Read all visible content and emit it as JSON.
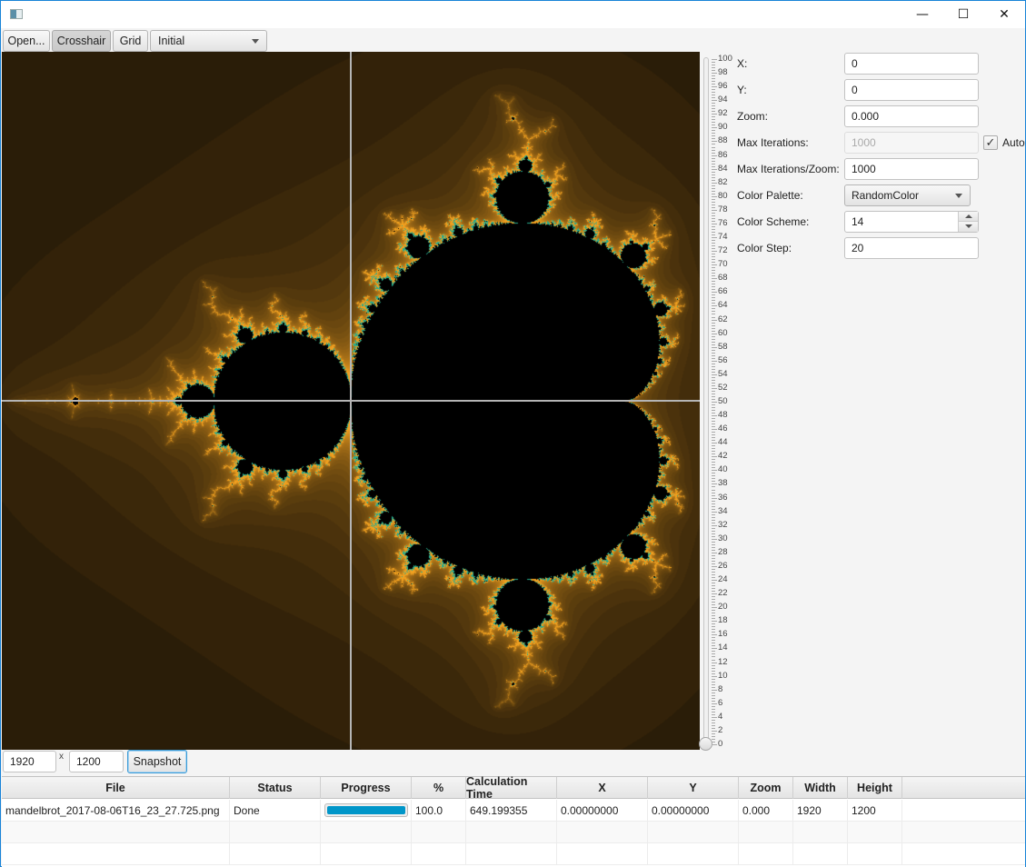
{
  "window": {
    "title": "",
    "controls": {
      "minimize": "—",
      "maximize": "☐",
      "close": "✕"
    }
  },
  "toolbar": {
    "open_label": "Open...",
    "crosshair_label": "Crosshair",
    "crosshair_pressed": true,
    "grid_label": "Grid",
    "preset_selected": "Initial"
  },
  "canvas": {
    "description": "Mandelbrot set render",
    "crosshair_visible": true,
    "colors": {
      "background": "#0c0904",
      "set": "#000000",
      "edge": "#f0a020",
      "crosshair": "#b5b5b5"
    }
  },
  "zoom_slider": {
    "min": 0,
    "max": 100,
    "value": 0,
    "tick_labels": [
      "100",
      "98",
      "96",
      "94",
      "92",
      "90",
      "88",
      "86",
      "84",
      "82",
      "80",
      "78",
      "76",
      "74",
      "72",
      "70",
      "68",
      "66",
      "64",
      "62",
      "60",
      "58",
      "56",
      "54",
      "52",
      "50",
      "48",
      "46",
      "44",
      "42",
      "40",
      "38",
      "36",
      "34",
      "32",
      "30",
      "28",
      "26",
      "24",
      "22",
      "20",
      "18",
      "16",
      "14",
      "12",
      "10",
      "8",
      "6",
      "4",
      "2",
      "0"
    ]
  },
  "properties": {
    "x": {
      "label": "X:",
      "value": "0"
    },
    "y": {
      "label": "Y:",
      "value": "0"
    },
    "zoom": {
      "label": "Zoom:",
      "value": "0.000"
    },
    "max_iterations": {
      "label": "Max Iterations:",
      "value": "1000",
      "disabled": true
    },
    "auto": {
      "label": "Auto",
      "checked": true,
      "check_glyph": "✓"
    },
    "max_iterations_zoom": {
      "label": "Max Iterations/Zoom:",
      "value": "1000"
    },
    "color_palette": {
      "label": "Color Palette:",
      "value": "RandomColor"
    },
    "color_scheme": {
      "label": "Color Scheme:",
      "value": "14"
    },
    "color_step": {
      "label": "Color Step:",
      "value": "20"
    }
  },
  "snapshot": {
    "width": "1920",
    "separator": "x",
    "height": "1200",
    "button_label": "Snapshot"
  },
  "table": {
    "columns": [
      "File",
      "Status",
      "Progress",
      "%",
      "Calculation Time",
      "X",
      "Y",
      "Zoom",
      "Width",
      "Height"
    ],
    "rows": [
      {
        "file": "mandelbrot_2017-08-06T16_23_27.725.png",
        "status": "Done",
        "progress": 1.0,
        "percent": "100.0",
        "calc_time": "649.199355",
        "x": "0.00000000",
        "y": "0.00000000",
        "zoom": "0.000",
        "width": "1920",
        "height": "1200"
      }
    ],
    "accent_color": "#0096c9"
  }
}
